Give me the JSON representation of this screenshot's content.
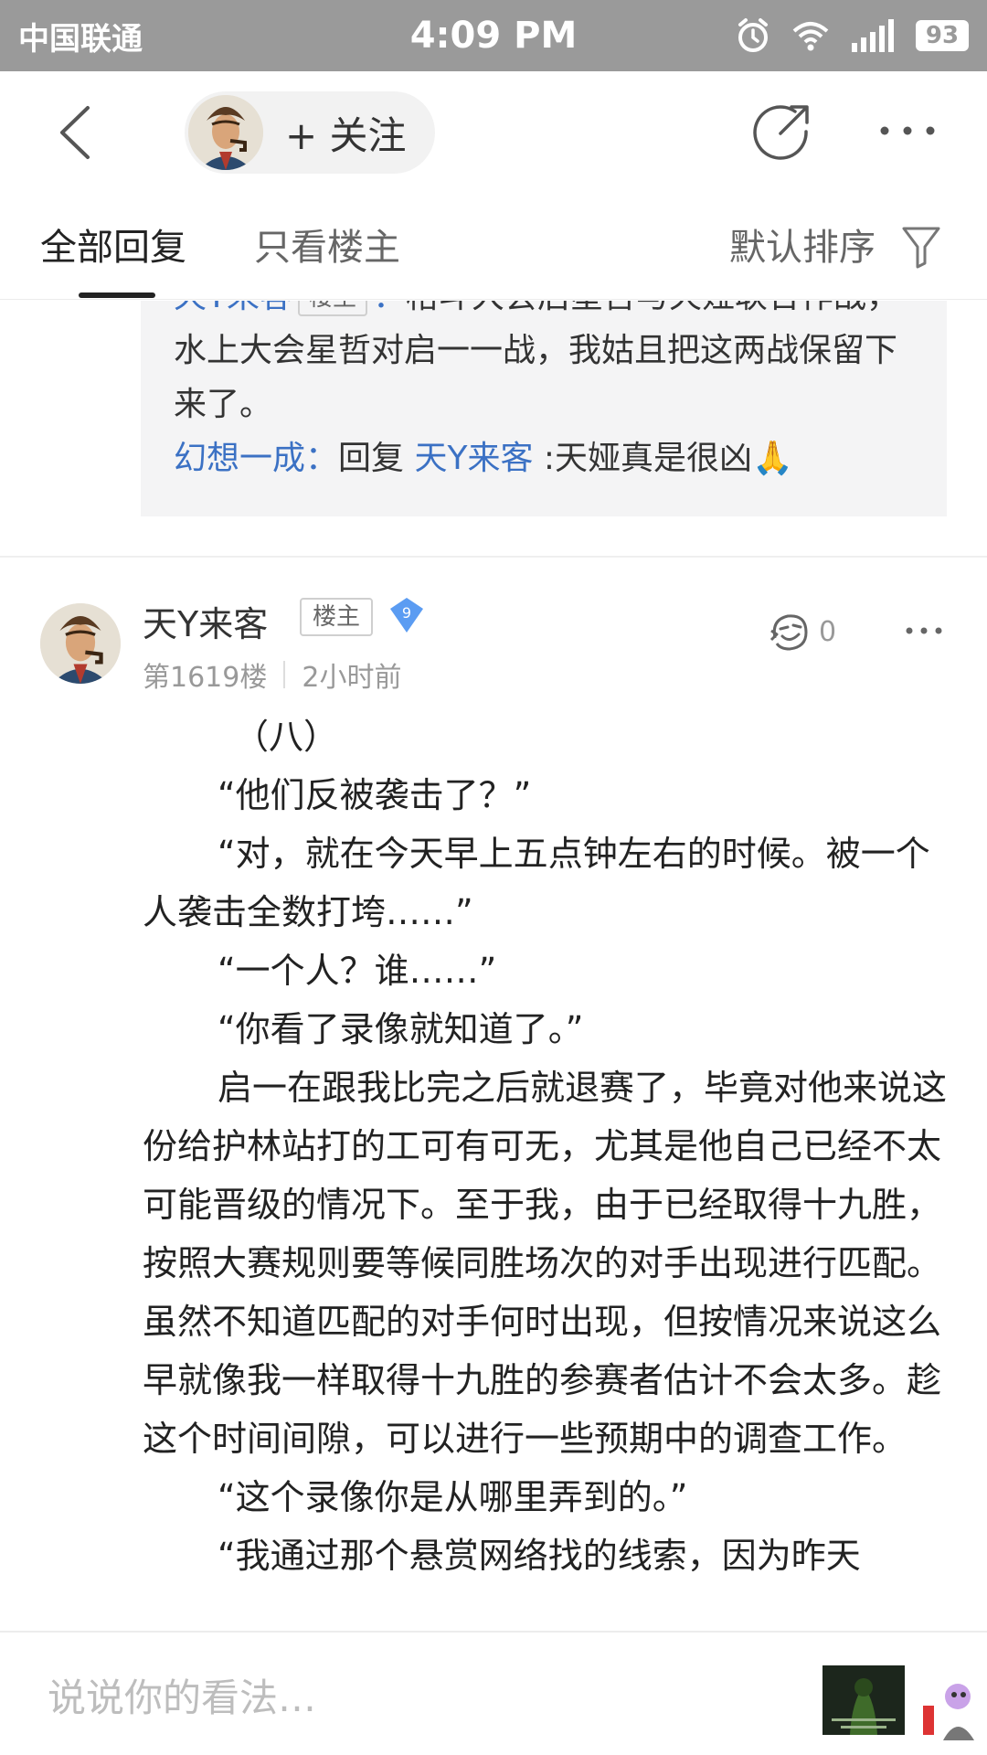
{
  "status_bar": {
    "carrier": "中国联通",
    "time": "4:09 PM",
    "battery": "93"
  },
  "nav": {
    "follow_label": "+ 关注"
  },
  "tabs": {
    "all_replies": "全部回复",
    "op_only": "只看楼主",
    "sort": "默认排序"
  },
  "previous_reply": {
    "line1_author": "天Y来客",
    "line1_badge": "楼主",
    "line1_sep": "：",
    "line1_text": "格斗大会后星哲与天娅联合作战，水上大会星哲对启一一战，我姑且把这两战保留下来了。",
    "line2_author": "幻想一成",
    "line2_sep": "：",
    "line2_reply_word": "回复 ",
    "line2_reply_to": "天Y来客",
    "line2_text": " :天娅真是很凶🙏"
  },
  "post": {
    "author": "天Y来客",
    "badge": "楼主",
    "level": "9",
    "floor": "第1619楼",
    "time": "2小时前",
    "reaction_count": "0",
    "paragraphs": [
      "（八）",
      "“他们反被袭击了？”",
      "“对，就在今天早上五点钟左右的时候。被一个人袭击全数打垮……”",
      "“一个人？谁……”",
      "“你看了录像就知道了。”",
      "启一在跟我比完之后就退赛了，毕竟对他来说这份给护林站打的工可有可无，尤其是他自己已经不太可能晋级的情况下。至于我，由于已经取得十九胜，按照大赛规则要等候同胜场次的对手出现进行匹配。虽然不知道匹配的对手何时出现，但按情况来说这么早就像我一样取得十九胜的参赛者估计不会太多。趁这个时间间隙，可以进行一些预期中的调查工作。",
      "“这个录像你是从哪里弄到的。”",
      "“我通过那个悬赏网络找的线索，因为昨天"
    ]
  },
  "comment_bar": {
    "placeholder": "说说你的看法…"
  },
  "colors": {
    "status_bar_bg": "#9a9a9a",
    "link_blue": "#3b71c4",
    "quote_bg": "#f4f4f5",
    "level_badge": "#5b9cf2"
  },
  "icons": {
    "back": "chevron-left-icon",
    "share": "share-icon",
    "more": "more-dots-icon",
    "filter": "filter-icon",
    "reaction": "reaction-face-icon",
    "alarm": "alarm-icon",
    "wifi": "wifi-icon",
    "signal": "signal-icon"
  }
}
